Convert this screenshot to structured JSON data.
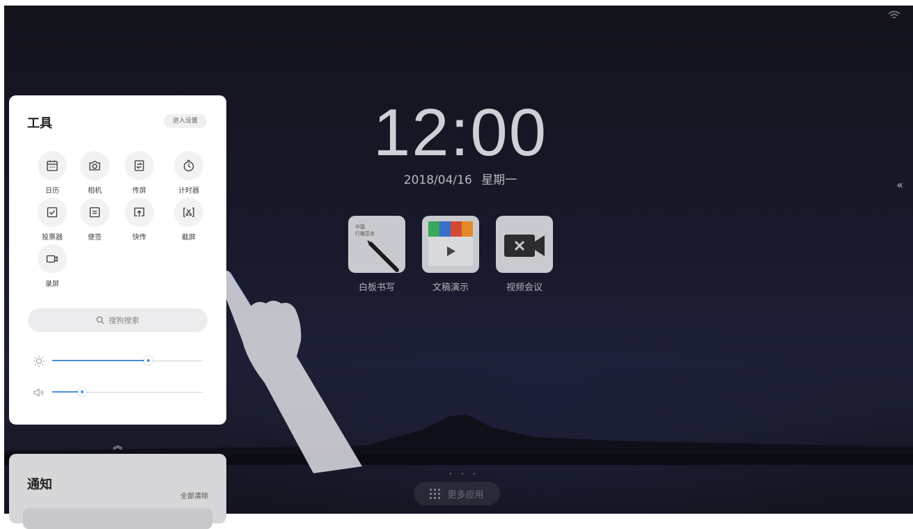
{
  "home": {
    "time": "12:00",
    "date": "2018/04/16",
    "weekday": "星期一",
    "collapse_icon": "«",
    "apps": [
      {
        "label": "白板书写",
        "icon": "whiteboard-icon"
      },
      {
        "label": "文稿演示",
        "icon": "presentation-icon"
      },
      {
        "label": "视频会议",
        "icon": "video-conference-icon"
      }
    ],
    "more_apps_label": "更多应用"
  },
  "tools_panel": {
    "title": "工具",
    "settings_label": "进入设置",
    "tools": [
      {
        "label": "日历",
        "icon": "calendar-icon"
      },
      {
        "label": "相机",
        "icon": "camera-icon"
      },
      {
        "label": "传屏",
        "icon": "screen-share-icon"
      },
      {
        "label": "计时器",
        "icon": "timer-icon"
      },
      {
        "label": "投票器",
        "icon": "vote-icon"
      },
      {
        "label": "便签",
        "icon": "sticky-note-icon"
      },
      {
        "label": "快传",
        "icon": "quick-transfer-icon"
      },
      {
        "label": "截屏",
        "icon": "screenshot-icon"
      },
      {
        "label": "录屏",
        "icon": "screen-record-icon"
      }
    ],
    "search_placeholder": "搜狗搜索",
    "brightness_level": 0.64,
    "volume_level": 0.2
  },
  "notifications": {
    "title": "通知",
    "clear_all_label": "全部清除"
  },
  "colors": {
    "accent": "#4a8fd8",
    "panel_bg": "#ffffff",
    "background": "#17182a"
  }
}
